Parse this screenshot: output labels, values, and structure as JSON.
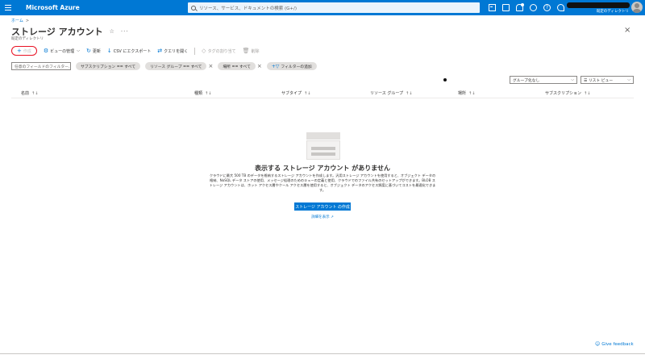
{
  "topbar": {
    "brand": "Microsoft Azure",
    "search_placeholder": "リソース、サービス、ドキュメントの検索 (G+/)",
    "account_directory": "既定のディレクトリ",
    "help_glyph": "?"
  },
  "breadcrumb": {
    "home": "ホーム",
    "sep": ">"
  },
  "page": {
    "title": "ストレージ アカウント",
    "pin_glyph": "☆",
    "more_glyph": "···",
    "subtitle": "既定のディレクトリ",
    "close_glyph": "×"
  },
  "toolbar": {
    "create": {
      "glyph": "+",
      "label": "作成"
    },
    "manage_view": {
      "glyph": "⚙",
      "label": "ビューの管理",
      "chevron": "⌵"
    },
    "refresh": {
      "glyph": "↻",
      "label": "更新"
    },
    "export_csv": {
      "glyph": "↓",
      "label": "CSV にエクスポート"
    },
    "open_query": {
      "glyph": "⇄",
      "label": "クエリを開く"
    },
    "assign_tags": {
      "glyph": "◇",
      "label": "タグの割り当て"
    },
    "delete": {
      "glyph": "🗑",
      "label": "削除"
    }
  },
  "filters": {
    "field_filter_placeholder": "任意のフィールドのフィルター...",
    "pills": [
      {
        "label": "サブスクリプション == すべて",
        "closable": false
      },
      {
        "label": "リソース グループ == すべて",
        "closable": true
      },
      {
        "label": "場所 == すべて",
        "closable": true
      }
    ],
    "pill_close_glyph": "×",
    "add_filter": {
      "glyph": "+▽",
      "label": "フィルターの追加"
    }
  },
  "view_controls": {
    "group_by": "グループ化なし",
    "view_type": "☰ リスト ビュー",
    "chevron": "⌵"
  },
  "table": {
    "sort_glyph": "↑↓",
    "columns": [
      "名前",
      "種類",
      "サブタイプ",
      "リソース グループ",
      "場所",
      "サブスクリプション"
    ]
  },
  "empty_state": {
    "title": "表示する ストレージ アカウント がありません",
    "description": "クラウドに最大 500 TB のデータを格納するストレージ アカウントを作成します。汎用ストレージ アカウントを使用すると、オブジェクト データの格納、NoSQL データ ストアの使用、メッセージ処理のためのキューの定義と使用、クラウドでのファイル共有のセットアップができます。BLOB ストレージ アカウントは、ホット アクセス層やクール アクセス層を使用すると、オブジェクト データのアクセス頻度に基づいてコストを最適化できます。",
    "create_button": "ストレージ アカウント の作成",
    "learn_more": "詳細を表示 ↗"
  },
  "feedback": {
    "glyph": "☺",
    "label": "Give feedback"
  },
  "colors": {
    "accent": "#0078d4",
    "highlight_ring": "#e81123"
  }
}
